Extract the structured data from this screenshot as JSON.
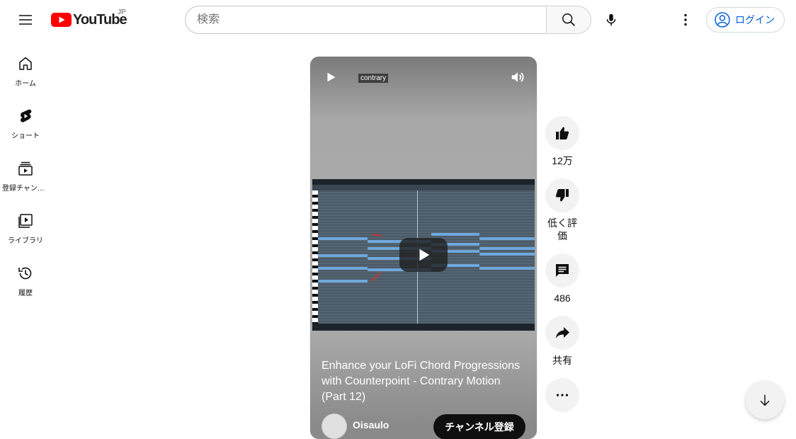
{
  "header": {
    "logo_text": "YouTube",
    "region": "JP",
    "search_placeholder": "検索",
    "login_label": "ログイン"
  },
  "sidebar": {
    "items": [
      {
        "label": "ホーム",
        "icon": "home-icon"
      },
      {
        "label": "ショート",
        "icon": "shorts-icon"
      },
      {
        "label": "登録チャンネル",
        "icon": "subscriptions-icon"
      },
      {
        "label": "ライブラリ",
        "icon": "library-icon"
      },
      {
        "label": "履歴",
        "icon": "history-icon"
      }
    ]
  },
  "video": {
    "tag": "contrary",
    "title": "Enhance your LoFi Chord Progressions with Counterpoint - Contrary Motion (Part 12)",
    "channel_name": "Oisaulo",
    "subscribe_label": "チャンネル登録"
  },
  "actions": {
    "like_count": "12万",
    "dislike_label": "低く評価",
    "comment_count": "486",
    "share_label": "共有"
  },
  "colors": {
    "brand_red": "#ff0000",
    "link_blue": "#065fd4"
  }
}
